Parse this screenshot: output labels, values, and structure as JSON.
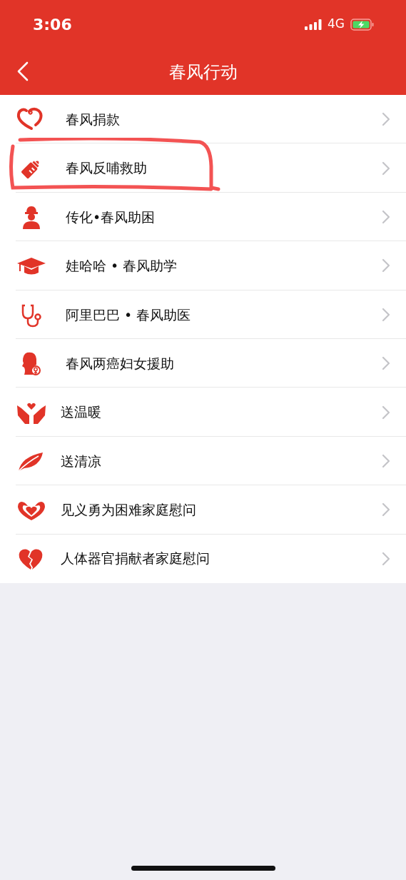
{
  "status_bar": {
    "time": "3:06",
    "network": "4G"
  },
  "nav": {
    "title": "春风行动"
  },
  "items": [
    {
      "label": "春风捐款",
      "highlighted": false
    },
    {
      "label": "春风反哺救助",
      "highlighted": true
    },
    {
      "label": "传化•春风助困",
      "highlighted": false
    },
    {
      "label": "娃哈哈 • 春风助学",
      "highlighted": false
    },
    {
      "label": "阿里巴巴 • 春风助医",
      "highlighted": false
    },
    {
      "label": "春风两癌妇女援助",
      "highlighted": false
    },
    {
      "label": "送温暖",
      "highlighted": false
    },
    {
      "label": "送清凉",
      "highlighted": false
    },
    {
      "label": "见义勇为困难家庭慰问",
      "highlighted": false
    },
    {
      "label": "人体器官捐献者家庭慰问",
      "highlighted": false
    }
  ]
}
